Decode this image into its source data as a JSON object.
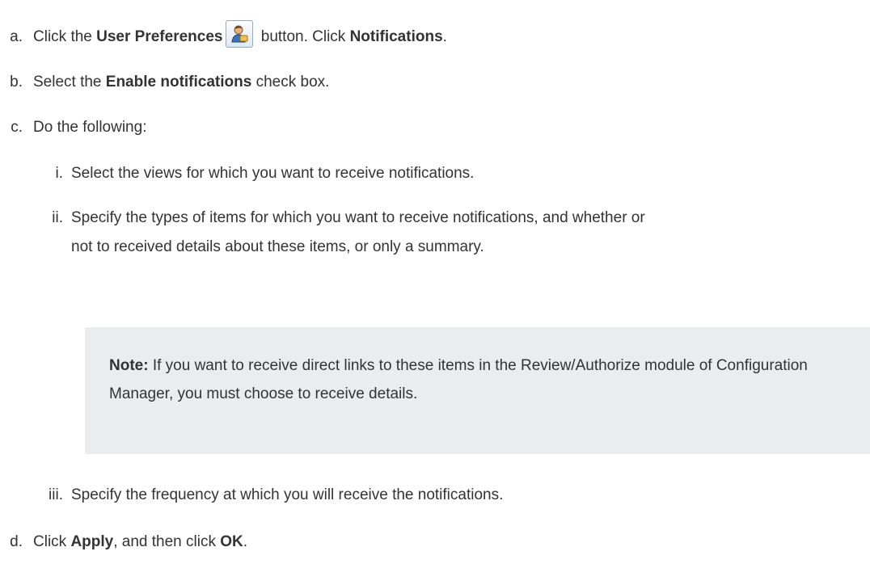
{
  "steps": {
    "a": {
      "marker": "a.",
      "pre": "Click the ",
      "bold1": "User Preferences",
      "post1": " button. Click ",
      "bold2": "Notifications",
      "post2": ".",
      "icon": "user-preferences-icon"
    },
    "b": {
      "marker": "b.",
      "pre": "Select the ",
      "bold1": "Enable notifications",
      "post1": " check box."
    },
    "c": {
      "marker": "c.",
      "text": "Do the following:",
      "substeps": [
        {
          "marker": "i.",
          "text": "Select the views for which you want to receive notifications."
        },
        {
          "marker": "ii.",
          "line1": "Specify the types of items for which you want to receive notifications, and whether or",
          "line2": "not to received details about these items, or only a summary."
        },
        {
          "marker": "iii.",
          "text": "Specify the frequency at which you will receive the notifications."
        }
      ]
    },
    "d": {
      "marker": "d.",
      "pre": "Click ",
      "bold1": "Apply",
      "post1": ", and then click ",
      "bold2": "OK",
      "post2": "."
    }
  },
  "note": {
    "label": "Note:",
    "text": " If you want to receive direct links to these items in the Review/Authorize module of Configuration Manager, you must choose to receive details."
  }
}
